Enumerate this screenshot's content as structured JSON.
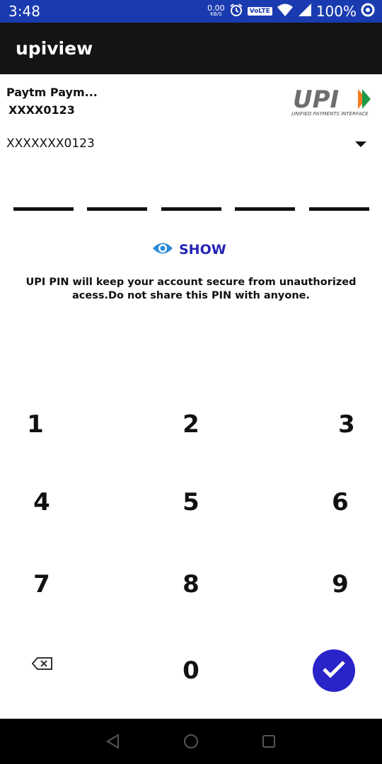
{
  "status_bar": {
    "time": "3:48",
    "net_speed_value": "0.00",
    "net_speed_unit": "KB/S",
    "volte": "VoLTE",
    "battery": "100%",
    "icons": [
      "alarm-icon",
      "wifi-icon",
      "signal-icon",
      "data-saver-icon"
    ]
  },
  "app_bar": {
    "title": "upiview"
  },
  "account": {
    "bank_name": "Paytm Paym...",
    "bank_account": "XXXX0123",
    "selected_account": "XXXXXXX0123",
    "logo_text": "UPI",
    "logo_subtitle": "UNIFIED PAYMENTS INTERFACE"
  },
  "pin": {
    "length": 5
  },
  "show_toggle": {
    "label": "SHOW"
  },
  "info_text": "UPI PIN will keep your account secure from unauthorized acess.Do not share this PIN with anyone.",
  "keypad": {
    "k1": "1",
    "k2": "2",
    "k3": "3",
    "k4": "4",
    "k5": "5",
    "k6": "6",
    "k7": "7",
    "k8": "8",
    "k9": "9",
    "k0": "0"
  },
  "colors": {
    "status_bar": "#1a3bb0",
    "app_bar": "#141414",
    "accent": "#2a24c8",
    "show_text": "#2424b5",
    "eye_icon": "#2a8ad8"
  }
}
